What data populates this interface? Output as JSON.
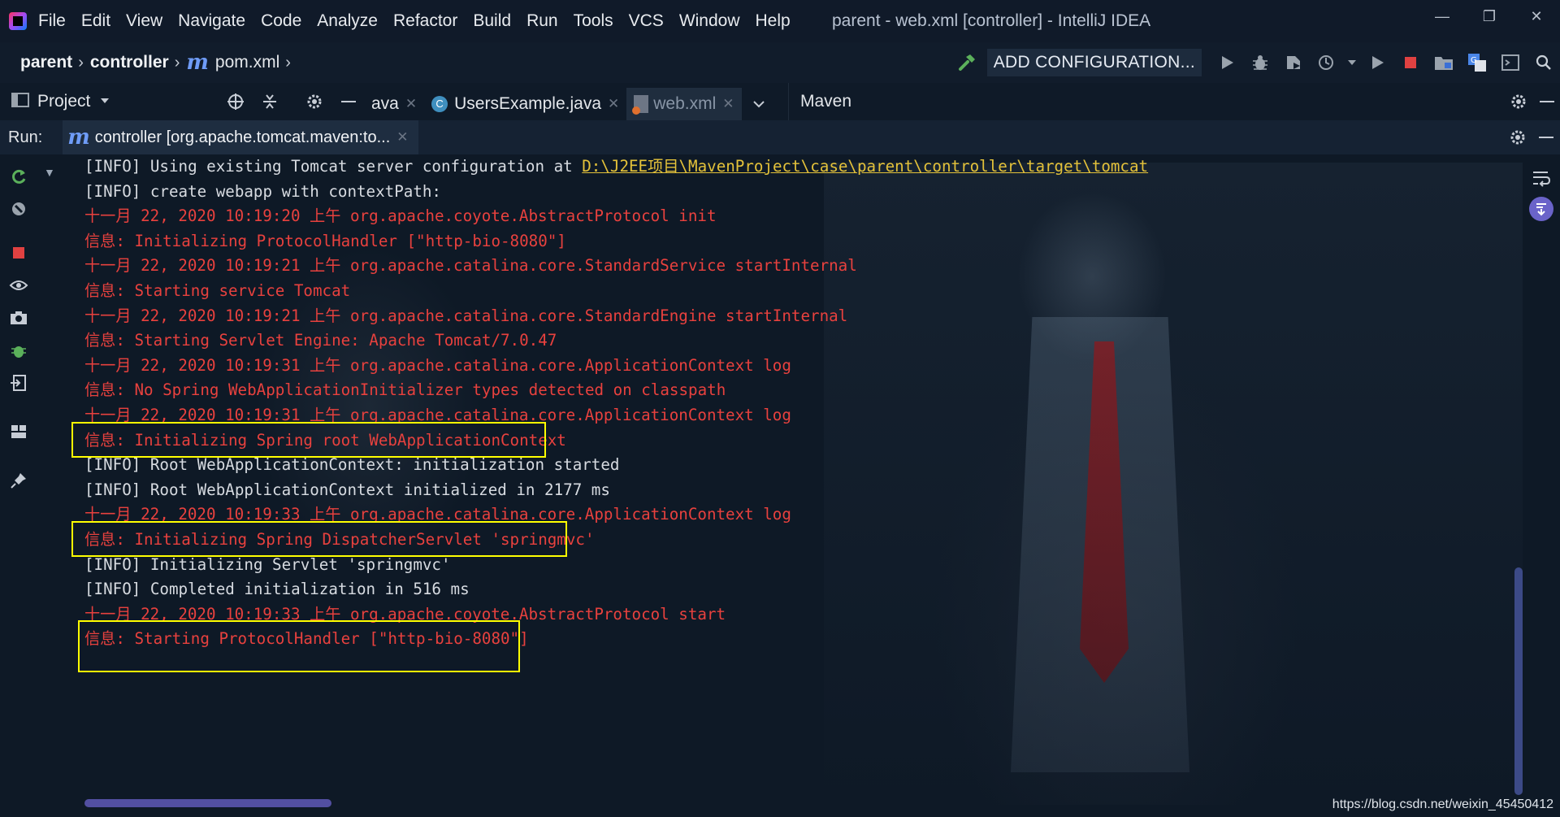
{
  "menubar": {
    "items": [
      "File",
      "Edit",
      "View",
      "Navigate",
      "Code",
      "Analyze",
      "Refactor",
      "Build",
      "Run",
      "Tools",
      "VCS",
      "Window",
      "Help"
    ],
    "window_title": "parent - web.xml [controller] - IntelliJ IDEA"
  },
  "navbar": {
    "crumbs": [
      "parent",
      "controller"
    ],
    "file_marker": "m",
    "file": "pom.xml",
    "config_label": "ADD CONFIGURATION..."
  },
  "tool_windows": {
    "project_label": "Project",
    "maven_label": "Maven"
  },
  "editor_tabs": [
    {
      "label": "ava",
      "active": false
    },
    {
      "label": "UsersExample.java",
      "active": false
    },
    {
      "label": "web.xml",
      "active": true
    }
  ],
  "run": {
    "label": "Run:",
    "tab_marker": "m",
    "tab_label": "controller [org.apache.tomcat.maven:to..."
  },
  "console": {
    "lines": [
      {
        "type": "info",
        "prefix": "[INFO] Using existing Tomcat server configuration at ",
        "link": "D:\\J2EE项目\\MavenProject\\case\\parent\\controller\\target\\tomcat"
      },
      {
        "type": "info",
        "text": "[INFO] create webapp with contextPath:"
      },
      {
        "type": "err",
        "text": "十一月 22, 2020 10:19:20 上午 org.apache.coyote.AbstractProtocol init"
      },
      {
        "type": "err",
        "text": "信息: Initializing ProtocolHandler [\"http-bio-8080\"]"
      },
      {
        "type": "err",
        "text": "十一月 22, 2020 10:19:21 上午 org.apache.catalina.core.StandardService startInternal"
      },
      {
        "type": "err",
        "text": "信息: Starting service Tomcat"
      },
      {
        "type": "err",
        "text": "十一月 22, 2020 10:19:21 上午 org.apache.catalina.core.StandardEngine startInternal"
      },
      {
        "type": "err",
        "text": "信息: Starting Servlet Engine: Apache Tomcat/7.0.47"
      },
      {
        "type": "err",
        "text": "十一月 22, 2020 10:19:31 上午 org.apache.catalina.core.ApplicationContext log"
      },
      {
        "type": "err",
        "text": "信息: No Spring WebApplicationInitializer types detected on classpath"
      },
      {
        "type": "err",
        "text": "十一月 22, 2020 10:19:31 上午 org.apache.catalina.core.ApplicationContext log"
      },
      {
        "type": "err",
        "text": "信息: Initializing Spring root WebApplicationContext",
        "highlight": true
      },
      {
        "type": "info",
        "text": "[INFO] Root WebApplicationContext: initialization started"
      },
      {
        "type": "info",
        "text": "[INFO] Root WebApplicationContext initialized in 2177 ms"
      },
      {
        "type": "err",
        "text": "十一月 22, 2020 10:19:33 上午 org.apache.catalina.core.ApplicationContext log"
      },
      {
        "type": "err",
        "text": "信息: Initializing Spring DispatcherServlet 'springmvc'",
        "highlight": true
      },
      {
        "type": "info",
        "text": "[INFO] Initializing Servlet 'springmvc'"
      },
      {
        "type": "info",
        "text": "[INFO] Completed initialization in 516 ms"
      },
      {
        "type": "err",
        "text": "十一月 22, 2020 10:19:33 上午 org.apache.coyote.AbstractProtocol start"
      },
      {
        "type": "err",
        "text": "信息: Starting ProtocolHandler [\"http-bio-8080\"]",
        "highlight": true
      }
    ]
  },
  "watermark": "https://blog.csdn.net/weixin_45450412",
  "colors": {
    "error_text": "#e8413e",
    "info_text": "#d7dbe1",
    "link": "#e4c23a",
    "highlight_box": "#ffff00"
  }
}
